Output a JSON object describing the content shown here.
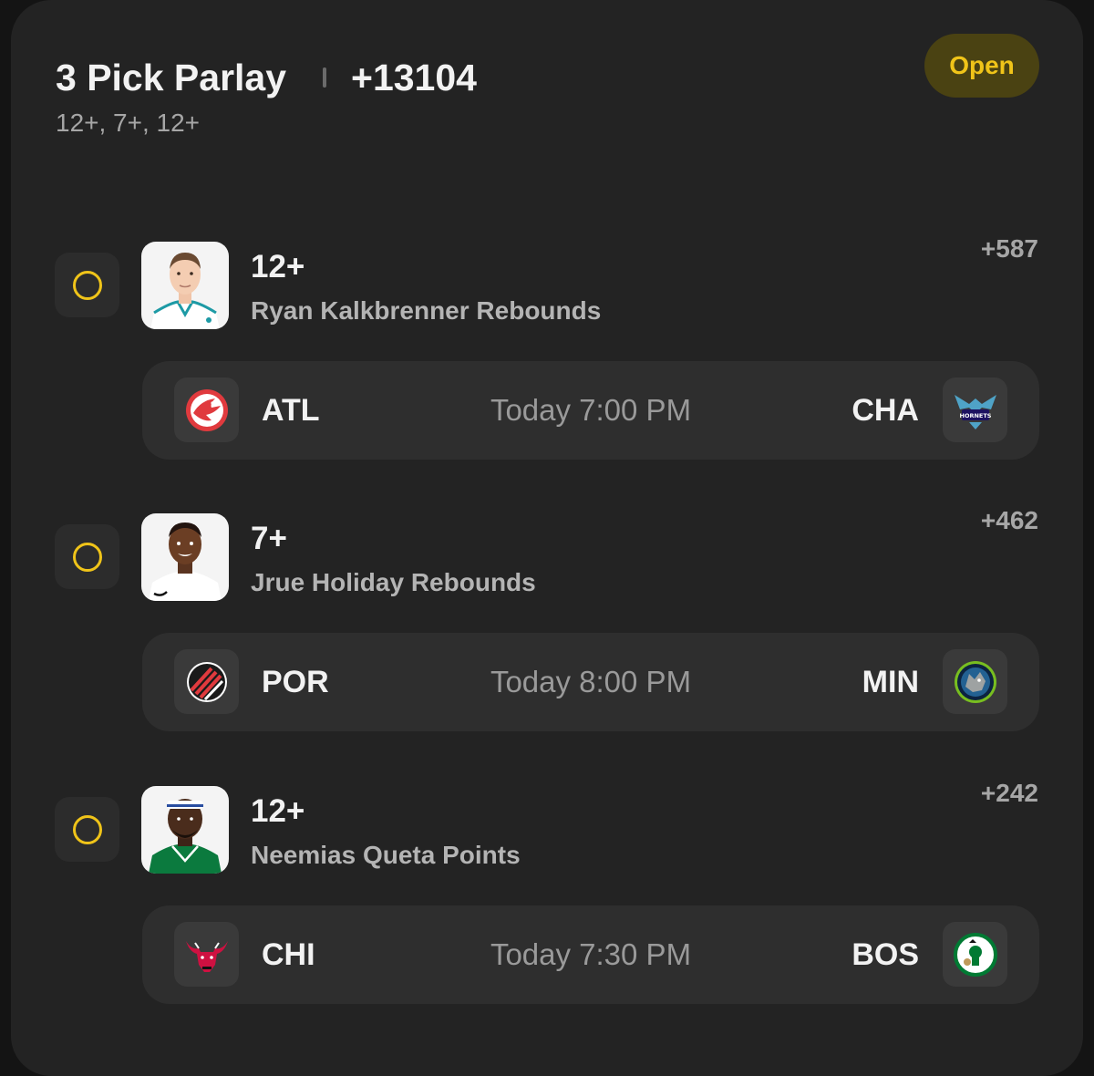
{
  "header": {
    "title": "3 Pick Parlay",
    "odds": "+13104",
    "subtitle": "12+, 7+, 12+",
    "status": "Open"
  },
  "legs": [
    {
      "line": "12+",
      "player": "Ryan Kalkbrenner Rebounds",
      "odds": "+587",
      "away_team": "ATL",
      "home_team": "CHA",
      "time": "Today 7:00 PM"
    },
    {
      "line": "7+",
      "player": "Jrue Holiday Rebounds",
      "odds": "+462",
      "away_team": "POR",
      "home_team": "MIN",
      "time": "Today 8:00 PM"
    },
    {
      "line": "12+",
      "player": "Neemias Queta Points",
      "odds": "+242",
      "away_team": "CHI",
      "home_team": "BOS",
      "time": "Today 7:30 PM"
    }
  ],
  "colors": {
    "accent": "#f0c419",
    "card": "#232323",
    "panel": "#2e2e2e"
  },
  "logo_text": {
    "hornets": "HORNETS"
  }
}
